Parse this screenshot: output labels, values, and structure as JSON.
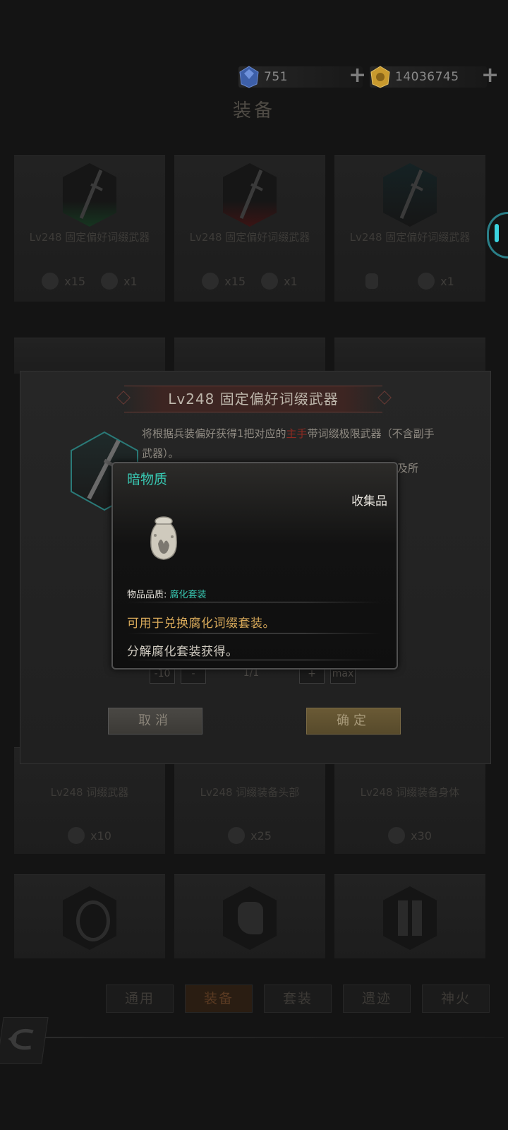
{
  "currency": {
    "gems": "751",
    "gold": "14036745",
    "gem_icon_color": "#3d5fa8",
    "gold_icon_color": "#c99a2e"
  },
  "page": {
    "title": "装备"
  },
  "grid": {
    "row1": [
      {
        "name": "Lv248 固定偏好词缀武器",
        "cost1": "x15",
        "cost2": "x1"
      },
      {
        "name": "Lv248 固定偏好词缀武器",
        "cost1": "x15",
        "cost2": "x1"
      },
      {
        "name": "Lv248 固定偏好词缀武器",
        "cost1": "",
        "cost2": "x1"
      }
    ],
    "row3": [
      {
        "name": "Lv248 词缀武器",
        "cost": "x10"
      },
      {
        "name": "Lv248 词缀装备头部",
        "cost": "x25"
      },
      {
        "name": "Lv248 词缀装备身体",
        "cost": "x30"
      }
    ]
  },
  "tabs": [
    "通用",
    "装备",
    "套装",
    "遗迹",
    "神火"
  ],
  "dialog": {
    "title": "Lv248 固定偏好词缀武器",
    "desc_part1": "将根据兵装偏好获得1把对应的",
    "desc_red": "主手",
    "desc_part2": "带词缀极限武器（不含副手武器）。",
    "desc_tail": "及所",
    "qty_min": "-10",
    "qty_dec": "-",
    "qty_value": "1/1",
    "qty_inc": "+",
    "qty_max": "max",
    "cancel_label": "取消",
    "confirm_label": "确定"
  },
  "tooltip": {
    "item_name": "暗物质",
    "category": "收集品",
    "quality_label": "物品品质: ",
    "quality_value": "腐化套装",
    "use_text": "可用于兑换腐化词缀套装。",
    "source_text": "分解腐化套装获得。",
    "accent_color": "#38c9b3"
  }
}
